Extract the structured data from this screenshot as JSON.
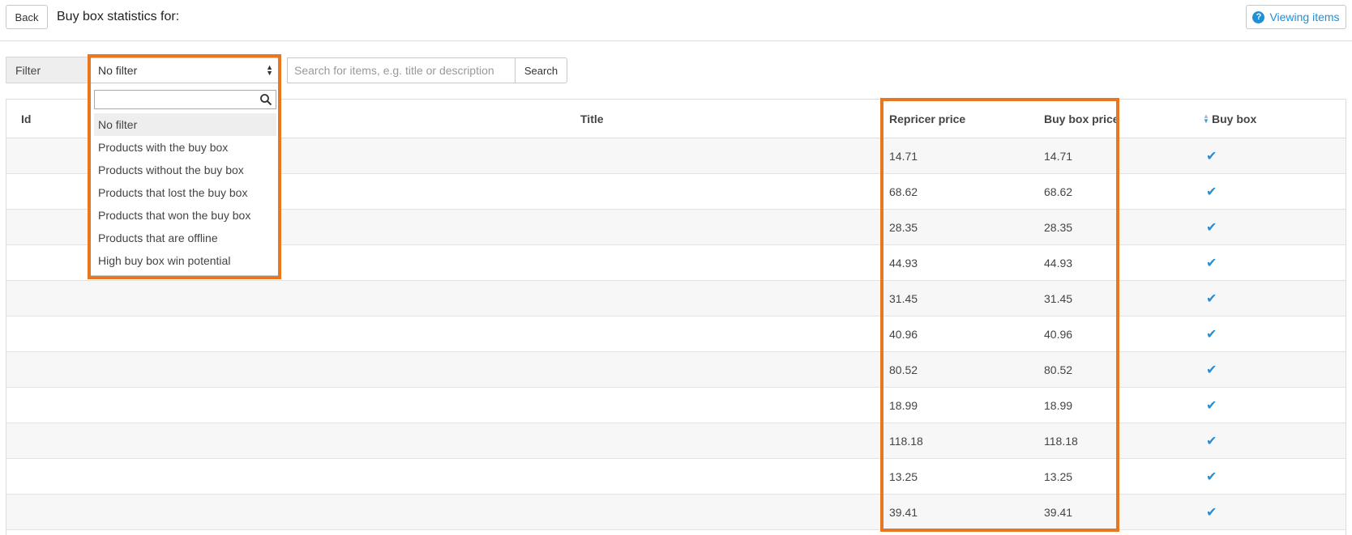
{
  "header": {
    "back_label": "Back",
    "title": "Buy box statistics for:",
    "viewing_items_label": "Viewing items",
    "help_glyph": "?"
  },
  "filter": {
    "label": "Filter",
    "selected": "No filter",
    "options": [
      "No filter",
      "Products with the buy box",
      "Products without the buy box",
      "Products that lost the buy box",
      "Products that won the buy box",
      "Products that are offline",
      "High buy box win potential"
    ]
  },
  "search": {
    "placeholder": "Search for items, e.g. title or description",
    "button_label": "Search"
  },
  "table": {
    "columns": {
      "id": "Id",
      "title": "Title",
      "repricer_price": "Repricer price",
      "buy_box_price": "Buy box price",
      "buy_box": "Buy box"
    },
    "rows": [
      {
        "repricer_price": "14.71",
        "buy_box_price": "14.71",
        "buy_box": "✔"
      },
      {
        "repricer_price": "68.62",
        "buy_box_price": "68.62",
        "buy_box": "✔"
      },
      {
        "repricer_price": "28.35",
        "buy_box_price": "28.35",
        "buy_box": "✔"
      },
      {
        "repricer_price": "44.93",
        "buy_box_price": "44.93",
        "buy_box": "✔"
      },
      {
        "repricer_price": "31.45",
        "buy_box_price": "31.45",
        "buy_box": "✔"
      },
      {
        "repricer_price": "40.96",
        "buy_box_price": "40.96",
        "buy_box": "✔"
      },
      {
        "repricer_price": "80.52",
        "buy_box_price": "80.52",
        "buy_box": "✔"
      },
      {
        "repricer_price": "18.99",
        "buy_box_price": "18.99",
        "buy_box": "✔"
      },
      {
        "repricer_price": "118.18",
        "buy_box_price": "118.18",
        "buy_box": "✔"
      },
      {
        "repricer_price": "13.25",
        "buy_box_price": "13.25",
        "buy_box": "✔"
      },
      {
        "repricer_price": "39.41",
        "buy_box_price": "39.41",
        "buy_box": "✔"
      }
    ]
  },
  "icons": {
    "help": "question-circle-icon",
    "select_arrows": "sort-arrows-icon",
    "dropdown_search": "search-icon",
    "sort": "sort-icon",
    "check": "check-icon"
  },
  "colors": {
    "accent": "#1e90d8",
    "highlight": "#e87722"
  }
}
